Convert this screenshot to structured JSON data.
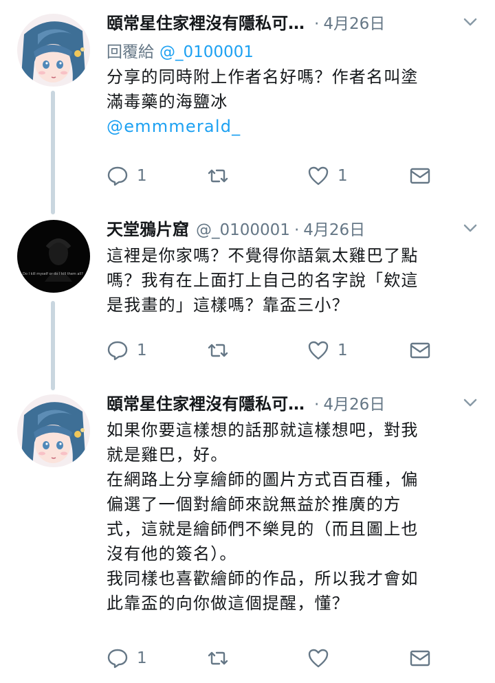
{
  "thread": {
    "tweets": [
      {
        "display_name": "頤常星住家裡沒有隱私可…",
        "handle": "",
        "separator": "·",
        "date": "4月26日",
        "reply_label": "回覆給",
        "reply_mention": "@_0100001",
        "lines": [
          "分享的同時附上作者名好嗎？作者名叫塗",
          "滿毒藥的海鹽冰"
        ],
        "link": "@emmmerald_",
        "reply_count": "1",
        "retweet_count": "",
        "like_count": "1"
      },
      {
        "display_name": "天堂鴉片窟",
        "handle": "@_0100001",
        "separator": "·",
        "date": "4月26日",
        "avatar_caption": "Do I kill myself or do I kill them all?",
        "lines": [
          "這裡是你家嗎？不覺得你語氣太雞巴了點",
          "嗎？我有在上面打上自己的名字說「欸這",
          "是我畫的」這樣嗎？靠盃三小？"
        ],
        "reply_count": "1",
        "retweet_count": "",
        "like_count": "1"
      },
      {
        "display_name": "頤常星住家裡沒有隱私可…",
        "handle": "",
        "separator": "·",
        "date": "4月26日",
        "lines": [
          "如果你要這樣想的話那就這樣想吧，對我",
          "就是雞巴，好。",
          "在網路上分享繪師的圖片方式百百種，偏",
          "偏選了一個對繪師來說無益於推廣的方",
          "式，這就是繪師們不樂見的（而且圖上也",
          "沒有他的簽名）。",
          "我同樣也喜歡繪師的作品，所以我才會如",
          "此靠盃的向你做這個提醒，懂？"
        ],
        "reply_count": "1",
        "retweet_count": "",
        "like_count": ""
      }
    ]
  },
  "colors": {
    "text": "#14171a",
    "muted": "#657786",
    "link": "#1da1f2",
    "thread_line": "#c9d6df"
  }
}
